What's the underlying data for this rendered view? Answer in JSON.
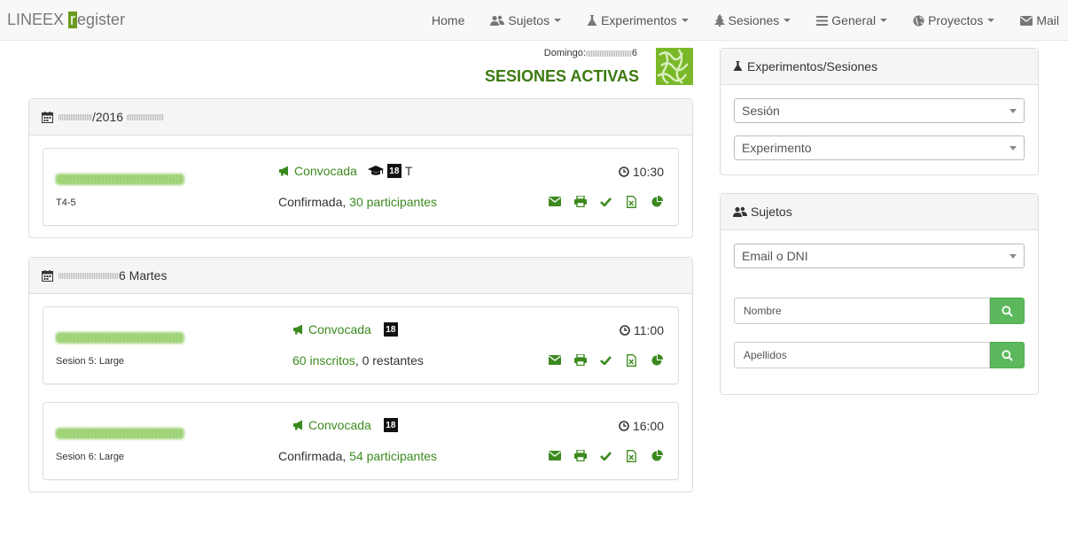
{
  "brand": {
    "left": "LINEEX",
    "r": "r",
    "rest": "egister"
  },
  "nav": [
    {
      "label": "Home",
      "icon": "none"
    },
    {
      "label": "Sujetos",
      "icon": "users-icon"
    },
    {
      "label": "Experimentos",
      "icon": "flask-icon"
    },
    {
      "label": "Sesiones",
      "icon": "tree-icon"
    },
    {
      "label": "General",
      "icon": "bars-icon"
    },
    {
      "label": "Proyectos",
      "icon": "globe-icon"
    },
    {
      "label": "Mail",
      "icon": "envelope-icon"
    }
  ],
  "header": {
    "date_prefix": "Domingo:",
    "date_suffix": "6",
    "title": "SESIONES ACTIVAS"
  },
  "days": [
    {
      "heading_prefix": "/2016",
      "sessions": [
        {
          "suffix": "5",
          "name": "T4-5",
          "status": "Convocada",
          "extra": "T",
          "time": "10:30",
          "info_plain": "Confirmada, ",
          "info_green": "30 participantes",
          "info_tail": ""
        }
      ]
    },
    {
      "heading_prefix": "6 Martes",
      "sessions": [
        {
          "suffix": "5",
          "name": "Sesion 5: Large",
          "status": "Convocada",
          "extra": "",
          "time": "11:00",
          "info_plain": "",
          "info_green": "60 inscritos",
          "info_tail": ", 0 restantes"
        },
        {
          "suffix": "6",
          "name": "Sesion 6: Large",
          "status": "Convocada",
          "extra": "",
          "time": "16:00",
          "info_plain": "Confirmada, ",
          "info_green": "54 participantes",
          "info_tail": ""
        }
      ]
    }
  ],
  "badge": "18",
  "sidebar": {
    "exp_title": "Experimentos/Sesiones",
    "session_placeholder": "Sesión",
    "experiment_placeholder": "Experimento",
    "subjects_title": "Sujetos",
    "email_placeholder": "Email o DNI",
    "name_placeholder": "Nombre",
    "surname_placeholder": "Apellidos"
  },
  "colors": {
    "accent": "#3c8a1f",
    "brand_green": "#6a9b1f",
    "button_green": "#5cb85c"
  }
}
